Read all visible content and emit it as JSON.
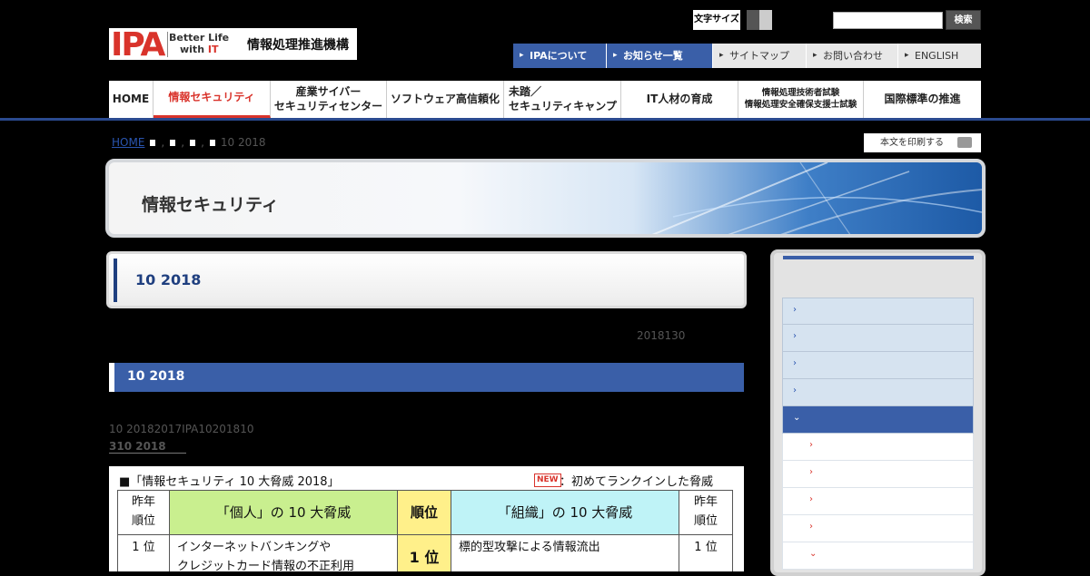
{
  "header": {
    "logo_text": "IPA",
    "logo_tagline_1": "Better Life",
    "logo_tagline_2a": "with ",
    "logo_tagline_2b": "IT",
    "org_name": "情報処理推進機構",
    "font_size_label": "文字サイズ",
    "search_placeholder": "",
    "search_button": "検索"
  },
  "util_nav": [
    {
      "label": "IPAについて"
    },
    {
      "label": "お知らせ一覧"
    },
    {
      "label": "サイトマップ"
    },
    {
      "label": "お問い合わせ"
    },
    {
      "label": "ENGLISH"
    }
  ],
  "global_nav": {
    "home": "HOME",
    "security": "情報セキュリティ",
    "cyber_1": "産業サイバー",
    "cyber_2": "セキュリティセンター",
    "software": "ソフトウェア高信頼化",
    "mitou_1": "未踏／",
    "mitou_2": "セキュリティキャンプ",
    "it_hr": "IT人材の育成",
    "exam_1": "情報処理技術者試験",
    "exam_2": "情報処理安全確保支援士試験",
    "standards": "国際標準の推進"
  },
  "breadcrumb": {
    "home": "HOME",
    "sep": ",",
    "current": "10 2018"
  },
  "print_button": "本文を印刷する",
  "banner_title": "情報セキュリティ",
  "page_title": "10 2018",
  "published_date": "2018130",
  "section_heading": "10 2018",
  "lead_text": "10 20182017IPA10201810",
  "lead_link": "310 2018",
  "table": {
    "title": "■「情報セキュリティ 10 大脅威 2018」",
    "new_badge": "NEW",
    "new_note": "：初めてランクインした脅威",
    "col_prev_year_1": "昨年",
    "col_prev_year_2": "順位",
    "col_personal": "「個人」の 10 大脅威",
    "col_rank": "順位",
    "col_org": "「組織」の 10 大脅威",
    "col_prev_year_r1": "昨年",
    "col_prev_year_r2": "順位",
    "row1_prev_personal": "1 位",
    "row1_personal_1": "インターネットバンキングや",
    "row1_personal_2": "クレジットカード情報の不正利用",
    "row1_rank": "1 位",
    "row1_org": "標的型攻撃による情報流出",
    "row1_prev_org": "1 位"
  },
  "colors": {
    "accent_blue": "#3a5fa8",
    "accent_red": "#d9332b",
    "personal_col": "#c9ef8f",
    "rank_col": "#fff08a",
    "org_col": "#bff3f7"
  }
}
